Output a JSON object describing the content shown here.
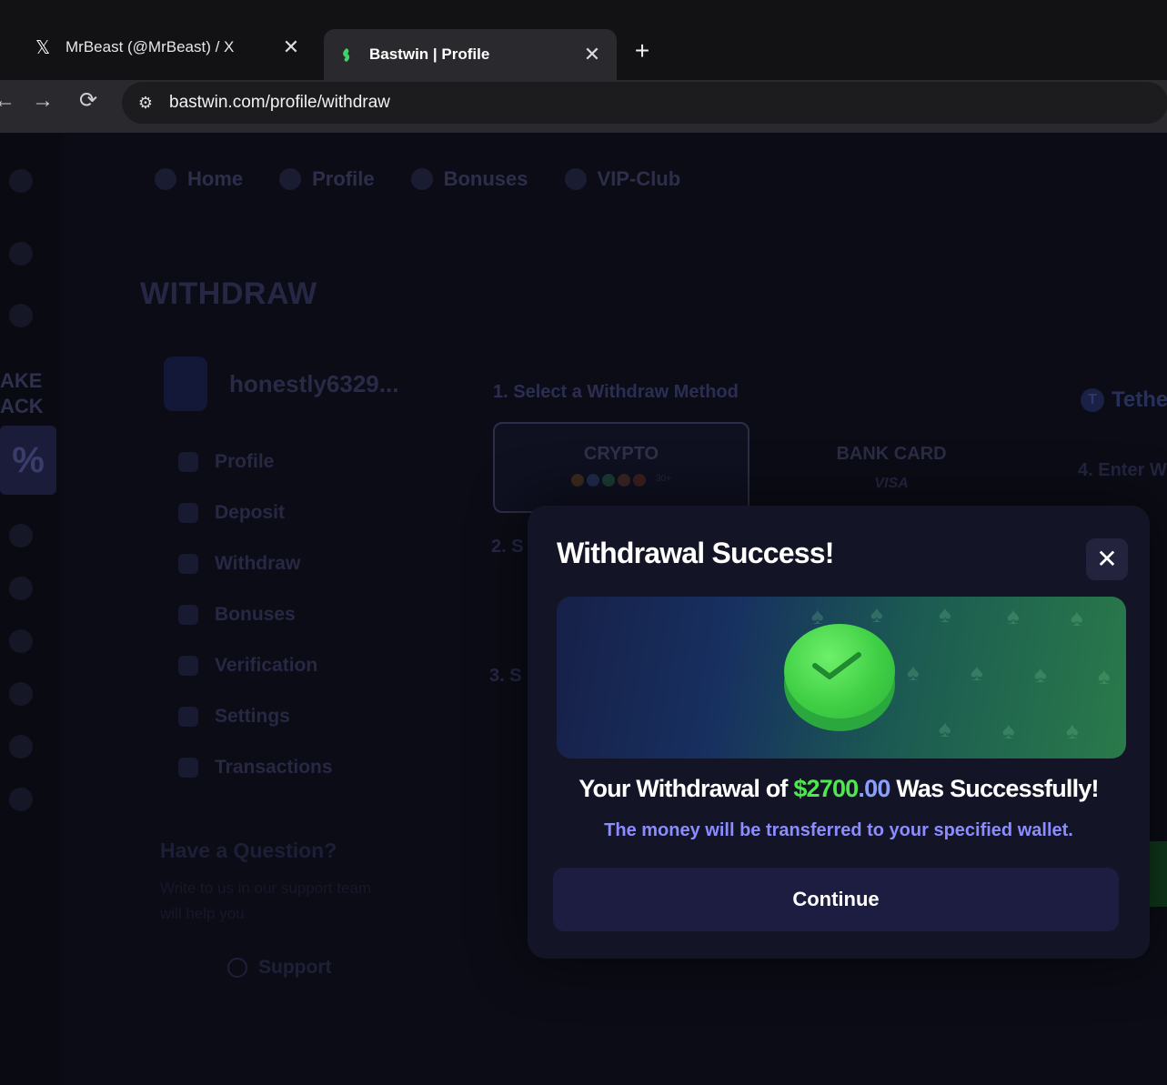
{
  "browser": {
    "tabs": [
      {
        "title": "MrBeast (@MrBeast) / X",
        "icon": "x-logo-icon",
        "active": false
      },
      {
        "title": "Bastwin | Profile",
        "icon": "bastwin-logo-icon",
        "active": true
      }
    ],
    "url": "bastwin.com/profile/withdraw"
  },
  "topnav": [
    "Home",
    "Profile",
    "Bonuses",
    "VIP-Club"
  ],
  "left_rail": {
    "rakeback_line1": "AKE",
    "rakeback_line2": "ACK",
    "badge": "%"
  },
  "page": {
    "title": "WITHDRAW",
    "username": "honestly6329...",
    "menu": [
      "Profile",
      "Deposit",
      "Withdraw",
      "Bonuses",
      "Verification",
      "Settings",
      "Transactions"
    ],
    "question_title": "Have a Question?",
    "question_text": "Write to us in our support team will help you",
    "support_label": "Support",
    "step1": "1. Select a Withdraw Method",
    "step2": "2. S",
    "step3": "3. S",
    "method_crypto": "CRYPTO",
    "method_crypto_more": "30+",
    "method_bank": "BANK CARD",
    "method_bank_sub": "VISA",
    "tether": "Tethe",
    "enter": "4. Enter W"
  },
  "modal": {
    "title": "Withdrawal Success!",
    "message_prefix": "Your Withdrawal of ",
    "amount_int": "$2700",
    "amount_dec": ".00",
    "message_suffix": " Was Successfully!",
    "subtext": "The money will be transferred to your specified wallet.",
    "continue_label": "Continue"
  },
  "colors": {
    "accent_green": "#4cea4a",
    "accent_purple": "#8b8cff",
    "modal_bg": "#141427"
  }
}
